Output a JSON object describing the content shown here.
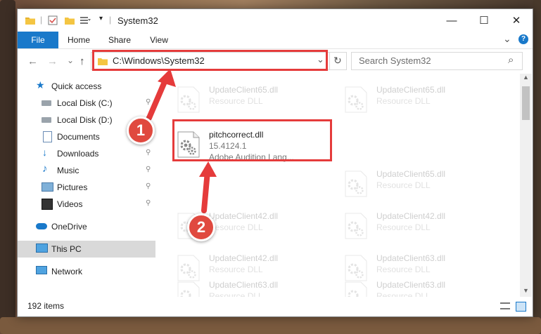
{
  "window": {
    "title": "System32",
    "controls": {
      "minimize": "—",
      "maximize": "☐",
      "close": "✕"
    }
  },
  "ribbon": {
    "tabs": [
      "File",
      "Home",
      "Share",
      "View"
    ],
    "expand_glyph": "⌄",
    "help_glyph": "?"
  },
  "nav": {
    "back": "←",
    "forward": "→",
    "recent": "⌄",
    "up": "↑",
    "address": "C:\\Windows\\System32",
    "address_dropdown": "⌄",
    "refresh": "↻",
    "search_placeholder": "Search System32",
    "search_glyph": "⌕"
  },
  "sidebar": {
    "items": [
      {
        "label": "Quick access",
        "icon": "star-icon"
      },
      {
        "label": "Local Disk (C:)",
        "icon": "drive-icon"
      },
      {
        "label": "Local Disk (D:)",
        "icon": "drive-icon"
      },
      {
        "label": "Documents",
        "icon": "document-icon"
      },
      {
        "label": "Downloads",
        "icon": "download-icon"
      },
      {
        "label": "Music",
        "icon": "music-icon"
      },
      {
        "label": "Pictures",
        "icon": "picture-icon"
      },
      {
        "label": "Videos",
        "icon": "video-icon"
      },
      {
        "label": "OneDrive",
        "icon": "cloud-icon"
      },
      {
        "label": "This PC",
        "icon": "computer-icon"
      },
      {
        "label": "Network",
        "icon": "network-icon"
      }
    ],
    "pin_glyph": "📌"
  },
  "files": [
    {
      "name": "UpdateClient65.dll",
      "type": "Resource DLL"
    },
    {
      "name": "UpdateClient65.dll",
      "type": "Resource DLL"
    },
    {
      "name": "UpdateClient65.dll",
      "type": "Resource DLL"
    },
    {
      "name": "UpdateClient42.dll",
      "type": "Resource DLL"
    },
    {
      "name": "UpdateClient42.dll",
      "type": "Resource DLL"
    },
    {
      "name": "UpdateClient42.dll",
      "type": "Resource DLL"
    },
    {
      "name": "UpdateClient63.dll",
      "type": "Resource DLL"
    },
    {
      "name": "UpdateClient63.dll",
      "type": "Resource DLL"
    },
    {
      "name": "UpdateClient63.dll",
      "type": "Resource DLL"
    }
  ],
  "highlighted_file": {
    "name": "pitchcorrect.dll",
    "version": "15.4124.1",
    "description": "Adobe Audition Lang..."
  },
  "status": {
    "item_count": "192 items"
  },
  "annotations": {
    "step1": "1",
    "step2": "2"
  },
  "colors": {
    "accent": "#1979ca",
    "annotation_red": "#e53b3b",
    "selected_bg": "#d9d9d9"
  }
}
